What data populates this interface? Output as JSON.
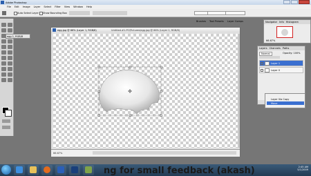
{
  "app": {
    "title": "Adobe Photoshop",
    "logo_icon": "photoshop-logo-icon"
  },
  "menu": [
    "File",
    "Edit",
    "Image",
    "Layer",
    "Select",
    "Filter",
    "View",
    "Window",
    "Help"
  ],
  "options_bar": {
    "auto_select": "Auto Select Layer",
    "bounding_box": "Show Bounding Box",
    "workspace_tabs": [
      "Brushes",
      "Tool Presets",
      "Layer Comps"
    ]
  },
  "minimized_doc": {
    "title": "egg 1, RGB/8"
  },
  "document": {
    "title": "Untitled-#1-PC\\Pictures\\egg.jpg @ 66% (Layer 1, RGB/8)",
    "title_short": "egg.jpg @ 66% (Layer 1, RGB/8)",
    "status": "66.67%"
  },
  "navigator": {
    "tabs": [
      "Navigator",
      "Info",
      "Histogram"
    ],
    "zoom": "66.67%"
  },
  "layers": {
    "tabs": [
      "Layers",
      "Channels",
      "Paths"
    ],
    "blend_mode": "Normal",
    "opacity": "Opacity: 100%",
    "items": [
      {
        "name": "Layer 1",
        "selected": true
      },
      {
        "name": "Layer 0",
        "selected": false
      }
    ]
  },
  "history": {
    "items": [
      {
        "name": "Layer Via Copy",
        "selected": false
      },
      {
        "name": "Move",
        "selected": true
      }
    ]
  },
  "taskbar": {
    "time": "2:45 AM",
    "date": "5/1/2009"
  },
  "overlay_text": "ng for small feedback (akash)"
}
